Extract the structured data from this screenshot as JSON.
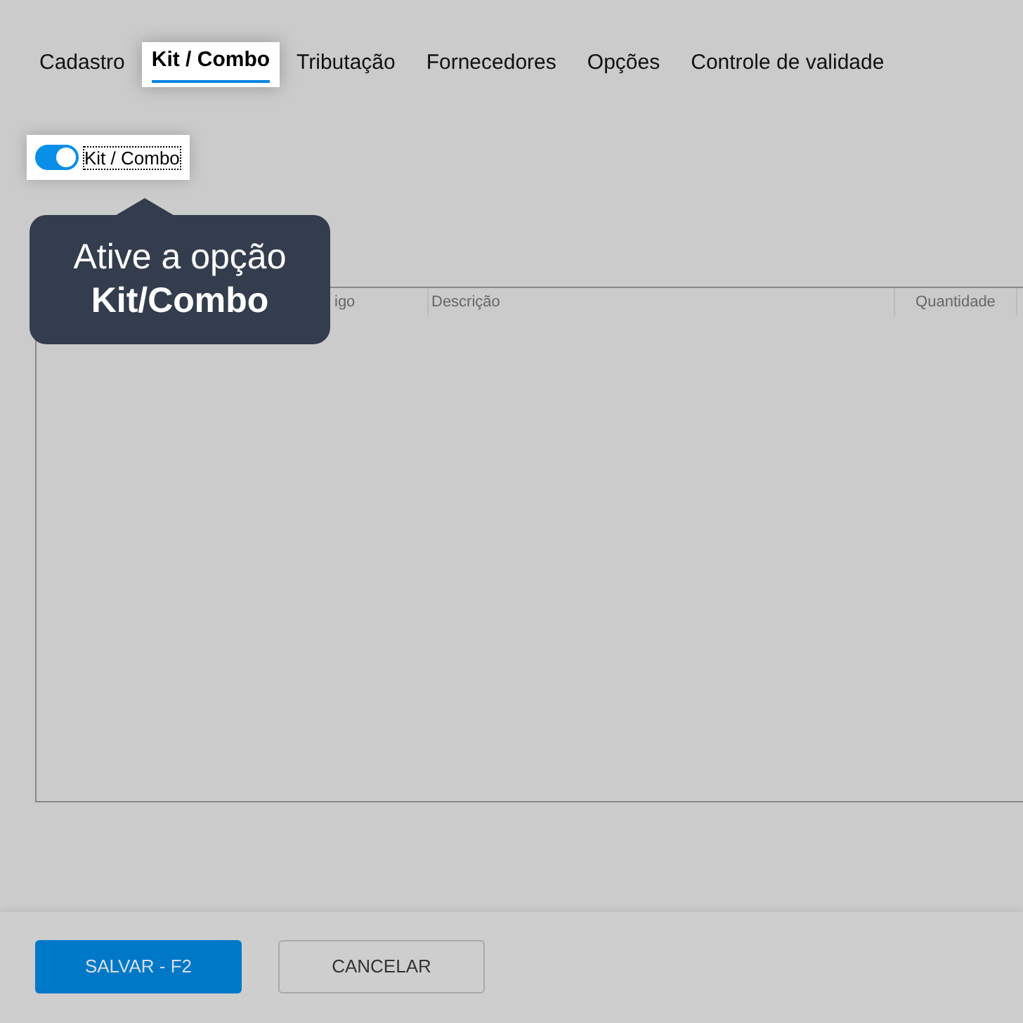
{
  "tabs": [
    {
      "label": "Cadastro",
      "selected": false
    },
    {
      "label": "Kit / Combo",
      "selected": true
    },
    {
      "label": "Tributação",
      "selected": false
    },
    {
      "label": "Fornecedores",
      "selected": false
    },
    {
      "label": "Opções",
      "selected": false
    },
    {
      "label": "Controle de validade",
      "selected": false
    }
  ],
  "kit_toggle": {
    "label": "Kit / Combo",
    "on": true
  },
  "tooltip": {
    "text": "Ative a opção",
    "emphasis": "Kit/Combo"
  },
  "table": {
    "columns": [
      "igo",
      "Descrição",
      "Quantidade"
    ]
  },
  "buttons": [
    {
      "label": "SALVAR - F2",
      "kind": "primary"
    },
    {
      "label": "CANCELAR",
      "kind": "secondary"
    }
  ]
}
